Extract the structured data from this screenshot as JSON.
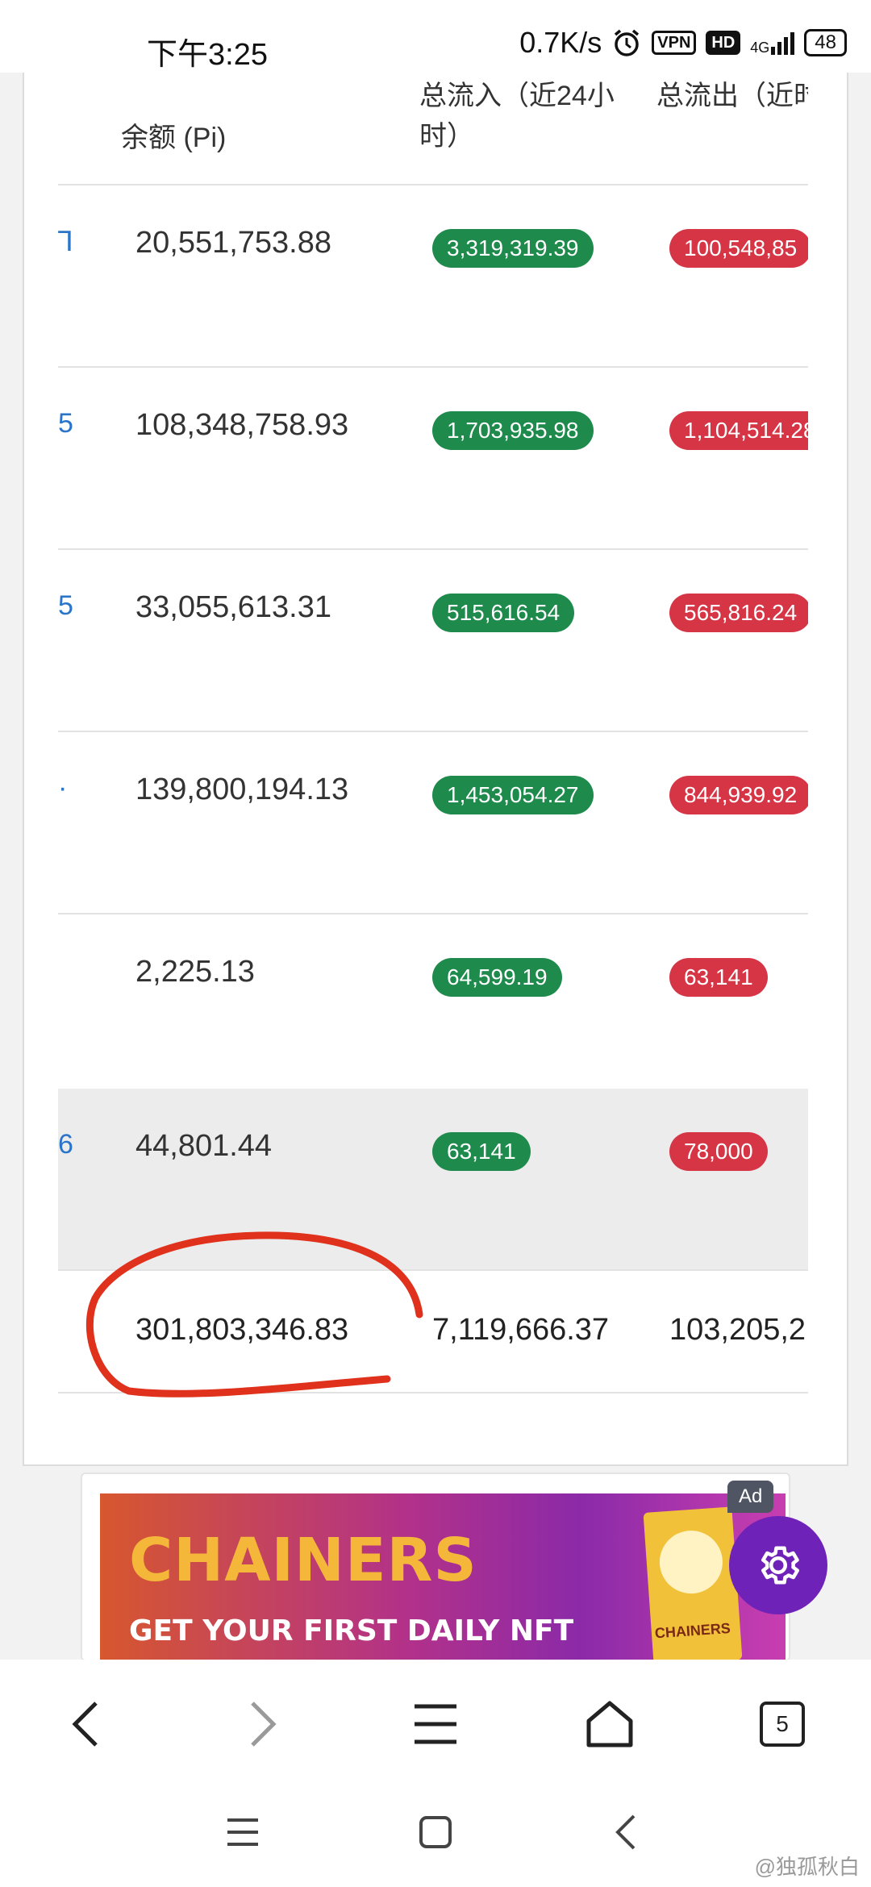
{
  "status_bar": {
    "time": "下午3:25",
    "net_speed": "0.7K/s",
    "vpn": "VPN",
    "hd": "HD",
    "network": "4G",
    "battery": "48"
  },
  "table": {
    "headers": {
      "balance": "余额 (Pi)",
      "inflow": "总流入（近24小时）",
      "outflow": "总流出（近时）"
    },
    "rows": [
      {
        "peek": "Ꞁ",
        "balance": "20,551,753.88",
        "inflow": "3,319,319.39",
        "outflow": "100,548,85"
      },
      {
        "peek": "5",
        "balance": "108,348,758.93",
        "inflow": "1,703,935.98",
        "outflow": "1,104,514.28"
      },
      {
        "peek": "5",
        "balance": "33,055,613.31",
        "inflow": "515,616.54",
        "outflow": "565,816.24"
      },
      {
        "peek": "·",
        "balance": "139,800,194.13",
        "inflow": "1,453,054.27",
        "outflow": "844,939.92"
      },
      {
        "peek": "",
        "balance": "2,225.13",
        "inflow": "64,599.19",
        "outflow": "63,141"
      },
      {
        "peek": "6",
        "balance": "44,801.44",
        "inflow": "63,141",
        "outflow": "78,000"
      }
    ],
    "total": {
      "balance": "301,803,346.83",
      "inflow": "7,119,666.37",
      "outflow": "103,205,2"
    }
  },
  "ad": {
    "badge": "Ad",
    "brand": "CHAINERS",
    "tagline": "GET YOUR FIRST DAILY NFT",
    "pack_label": "CHAINERS"
  },
  "browser_bar": {
    "tab_count": "5"
  },
  "watermark": "@独孤秋白",
  "colors": {
    "inflow_pill": "#1e8a4c",
    "outflow_pill": "#d63545",
    "annotation": "#e0311c",
    "fab": "#6f22b8"
  }
}
